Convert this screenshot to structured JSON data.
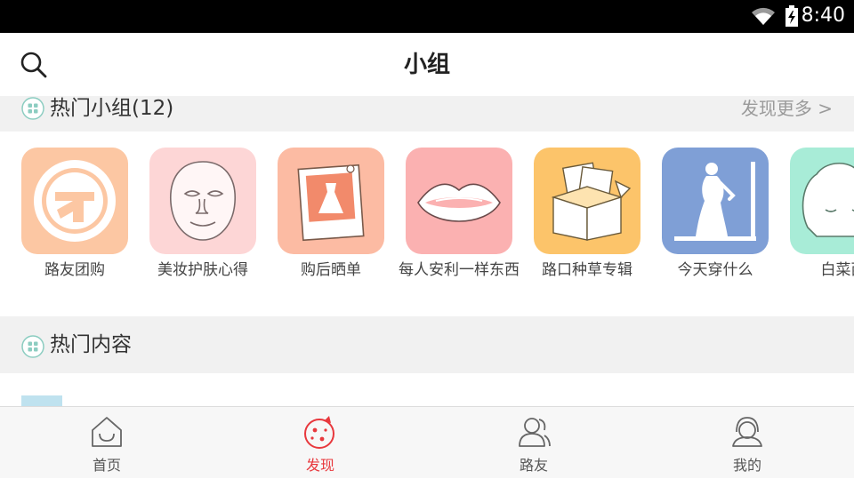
{
  "status": {
    "time": "8:40"
  },
  "header": {
    "title": "小组"
  },
  "groups_section": {
    "title": "热门小组(12)",
    "more": "发现更多 >",
    "items": [
      {
        "label": "路友团购",
        "icon": "logo-icon",
        "color": "#fcc7a3"
      },
      {
        "label": "美妆护肤心得",
        "icon": "face-mask-icon",
        "color": "#fdd6d6"
      },
      {
        "label": "购后晒单",
        "icon": "dress-photo-icon",
        "color": "#fcbba3"
      },
      {
        "label": "每人安利一样东西",
        "icon": "lips-icon",
        "color": "#fbb1b1"
      },
      {
        "label": "路口种草专辑",
        "icon": "box-icon",
        "color": "#fcc46a"
      },
      {
        "label": "今天穿什么",
        "icon": "mirror-icon",
        "color": "#7f9fd6"
      },
      {
        "label": "白菜西",
        "icon": "cabbage-icon",
        "color": "#a8ecd7"
      }
    ]
  },
  "content_section": {
    "title": "热门内容"
  },
  "tabs": [
    {
      "label": "首页",
      "icon": "home-icon"
    },
    {
      "label": "发现",
      "icon": "discover-icon",
      "active": true
    },
    {
      "label": "路友",
      "icon": "friends-icon"
    },
    {
      "label": "我的",
      "icon": "profile-icon"
    }
  ],
  "colors": {
    "accent": "#e8383d",
    "section_bg": "#f1f1f1",
    "section_icon": "#8ccdc1"
  }
}
